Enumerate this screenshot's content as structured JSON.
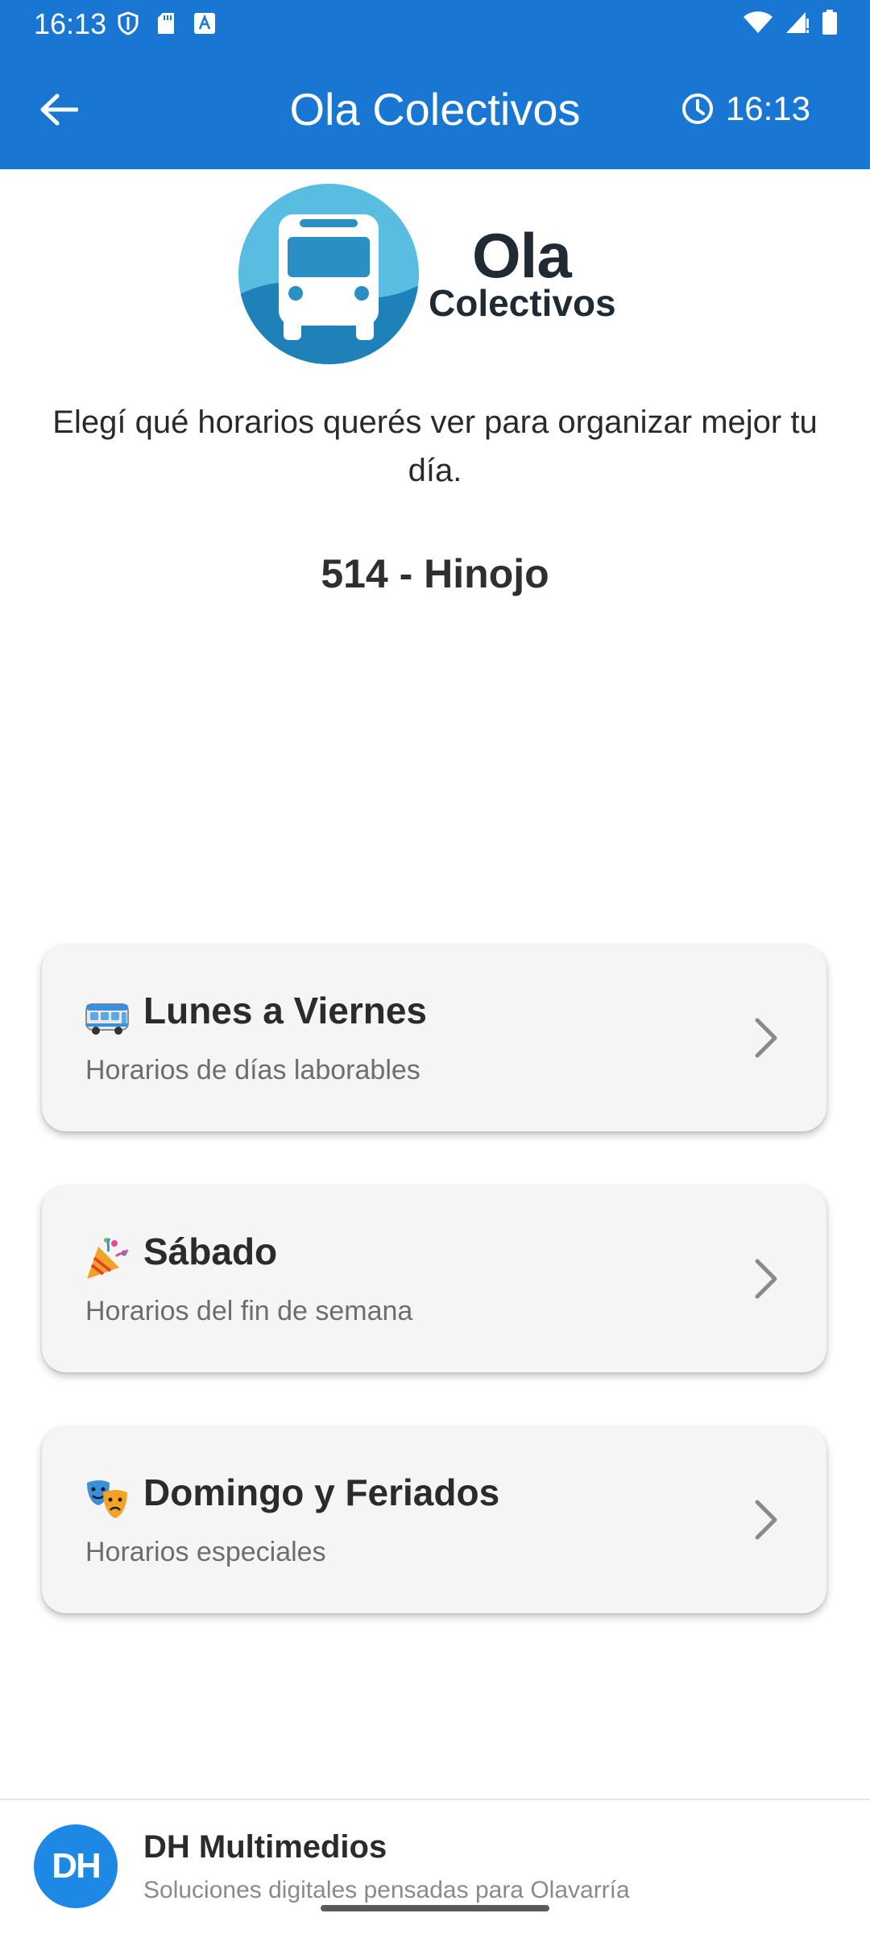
{
  "status_bar": {
    "time": "16:13",
    "left_icons": [
      "shield-icon",
      "sd-card-icon",
      "keyboard-a-icon"
    ],
    "right_icons": [
      "wifi-icon",
      "cell-signal-icon",
      "battery-icon"
    ]
  },
  "app_bar": {
    "title": "Ola Colectivos",
    "clock_time": "16:13",
    "back_icon": "arrow-back-icon",
    "clock_icon": "clock-icon",
    "color": "#1976D2"
  },
  "logo": {
    "word1": "Ola",
    "word2": "Colectivos",
    "icon": "bus-icon"
  },
  "intro_text": "Elegí qué horarios querés ver para organizar mejor tu día.",
  "route_name": "514 - Hinojo",
  "schedule_options": [
    {
      "emoji": "bus-emoji",
      "title": "Lunes a Viernes",
      "subtitle": "Horarios de días laborables"
    },
    {
      "emoji": "party-popper-emoji",
      "title": "Sábado",
      "subtitle": "Horarios del fin de semana"
    },
    {
      "emoji": "theater-masks-emoji",
      "title": "Domingo y Feriados",
      "subtitle": "Horarios especiales"
    }
  ],
  "footer": {
    "logo_text": "DH",
    "name": "DH Multimedios",
    "tagline": "Soluciones digitales pensadas para Olavarría",
    "color": "#1E88E5"
  }
}
